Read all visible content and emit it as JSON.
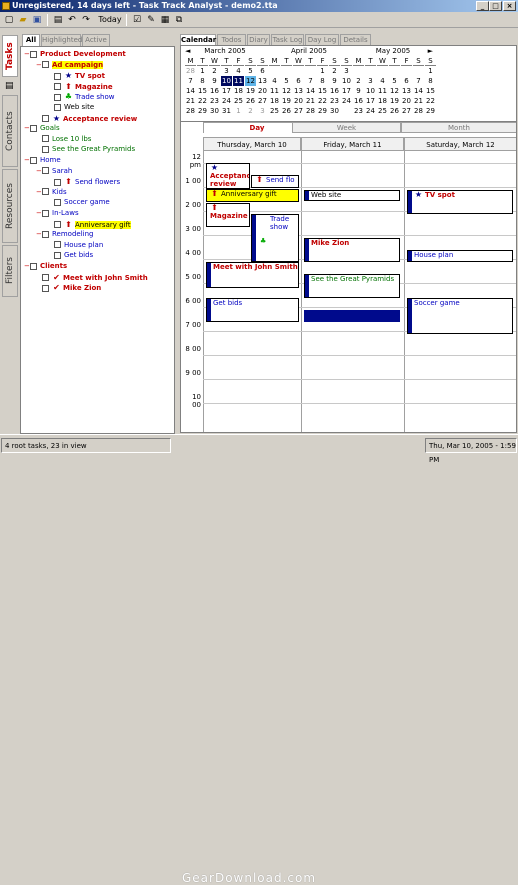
{
  "window": {
    "title": "Unregistered, 14 days left - Task Track Analyst - demo2.tta",
    "min": "_",
    "max": "□",
    "close": "×"
  },
  "toolbar": {
    "today_label": "Today"
  },
  "vtabs": [
    "Tasks",
    "Contacts",
    "Resources",
    "Filters"
  ],
  "left_tabs": [
    "All",
    "Highlighted",
    "Active"
  ],
  "tree": [
    {
      "label": "Product Development",
      "cls": "red",
      "indent": 0,
      "exp": "−",
      "icon": ""
    },
    {
      "label": "Ad campaign",
      "cls": "red hl",
      "indent": 1,
      "exp": "−",
      "icon": ""
    },
    {
      "label": "TV spot",
      "cls": "red",
      "indent": 2,
      "exp": "",
      "icon": "★"
    },
    {
      "label": "Magazine",
      "cls": "red",
      "indent": 2,
      "exp": "",
      "icon": "⬆"
    },
    {
      "label": "Trade show",
      "cls": "blue",
      "indent": 2,
      "exp": "",
      "icon": "♣"
    },
    {
      "label": "Web site",
      "cls": "",
      "indent": 2,
      "exp": "",
      "icon": ""
    },
    {
      "label": "Acceptance review",
      "cls": "red",
      "indent": 1,
      "exp": "",
      "icon": "★"
    },
    {
      "label": "Goals",
      "cls": "grn",
      "indent": 0,
      "exp": "−",
      "icon": ""
    },
    {
      "label": "Lose 10 lbs",
      "cls": "grn",
      "indent": 1,
      "exp": "",
      "icon": ""
    },
    {
      "label": "See the Great Pyramids",
      "cls": "grn",
      "indent": 1,
      "exp": "",
      "icon": ""
    },
    {
      "label": "Home",
      "cls": "blue",
      "indent": 0,
      "exp": "−",
      "icon": ""
    },
    {
      "label": "Sarah",
      "cls": "blue",
      "indent": 1,
      "exp": "−",
      "icon": ""
    },
    {
      "label": "Send flowers",
      "cls": "blue",
      "indent": 2,
      "exp": "",
      "icon": "⬆"
    },
    {
      "label": "Kids",
      "cls": "blue",
      "indent": 1,
      "exp": "−",
      "icon": ""
    },
    {
      "label": "Soccer game",
      "cls": "blue",
      "indent": 2,
      "exp": "",
      "icon": ""
    },
    {
      "label": "In-Laws",
      "cls": "blue",
      "indent": 1,
      "exp": "−",
      "icon": ""
    },
    {
      "label": "Anniversary gift",
      "cls": "hl",
      "indent": 2,
      "exp": "",
      "icon": "⬆"
    },
    {
      "label": "Remodeling",
      "cls": "blue",
      "indent": 1,
      "exp": "−",
      "icon": ""
    },
    {
      "label": "House plan",
      "cls": "blue",
      "indent": 2,
      "exp": "",
      "icon": ""
    },
    {
      "label": "Get bids",
      "cls": "blue",
      "indent": 2,
      "exp": "",
      "icon": ""
    },
    {
      "label": "Clients",
      "cls": "red",
      "indent": 0,
      "exp": "−",
      "icon": ""
    },
    {
      "label": "Meet with John Smith",
      "cls": "red",
      "indent": 1,
      "exp": "",
      "icon": "✔"
    },
    {
      "label": "Mike Zion",
      "cls": "red",
      "indent": 1,
      "exp": "",
      "icon": "✔"
    }
  ],
  "right_tabs": [
    "Calendar",
    "Todos",
    "Diary",
    "Task Log",
    "Day Log",
    "Details"
  ],
  "months": [
    {
      "name": "March 2005",
      "nav": "◄",
      "days": [
        "28",
        "1",
        "2",
        "3",
        "4",
        "5",
        "6",
        "7",
        "8",
        "9",
        "10",
        "11",
        "12",
        "13",
        "14",
        "15",
        "16",
        "17",
        "18",
        "19",
        "20",
        "21",
        "22",
        "23",
        "24",
        "25",
        "26",
        "27",
        "28",
        "29",
        "30",
        "31",
        "1",
        "2",
        "3"
      ]
    },
    {
      "name": "April 2005",
      "nav": "",
      "days": [
        "",
        "",
        "",
        "",
        "1",
        "2",
        "3",
        "4",
        "5",
        "6",
        "7",
        "8",
        "9",
        "10",
        "11",
        "12",
        "13",
        "14",
        "15",
        "16",
        "17",
        "18",
        "19",
        "20",
        "21",
        "22",
        "23",
        "24",
        "25",
        "26",
        "27",
        "28",
        "29",
        "30",
        ""
      ]
    },
    {
      "name": "May 2005",
      "nav": "►",
      "days": [
        "",
        "",
        "",
        "",
        "",
        "",
        "1",
        "2",
        "3",
        "4",
        "5",
        "6",
        "7",
        "8",
        "9",
        "10",
        "11",
        "12",
        "13",
        "14",
        "15",
        "16",
        "17",
        "18",
        "19",
        "20",
        "21",
        "22",
        "23",
        "24",
        "25",
        "26",
        "27",
        "28",
        "29"
      ]
    }
  ],
  "weekdays": [
    "M",
    "T",
    "W",
    "T",
    "F",
    "S",
    "S"
  ],
  "view_tabs": [
    "Day",
    "Week",
    "Month"
  ],
  "day_headers": [
    "Thursday, March 10",
    "Friday, March 11",
    "Saturday, March 12"
  ],
  "times": [
    "12 pm",
    "1 00",
    "2 00",
    "3 00",
    "4 00",
    "5 00",
    "6 00",
    "7 00",
    "8 00",
    "9 00",
    "10 00"
  ],
  "events": {
    "acceptance": "Acceptance review",
    "sendflo": "Send flo",
    "anniv": "Anniversary gift",
    "magazine": "Magazine",
    "tradeshow": "Trade show",
    "meet": "Meet with John Smith",
    "getbids": "Get bids",
    "website": "Web site",
    "mikezion": "Mike Zion",
    "pyramids": "See the Great Pyramids",
    "tvspot": "TV spot",
    "houseplan": "House plan",
    "soccer": "Soccer game"
  },
  "status": {
    "left": "4 root tasks, 23 in view",
    "right": "Thu, Mar 10, 2005 - 1:59 PM",
    "watermark": "GearDownload.com"
  }
}
